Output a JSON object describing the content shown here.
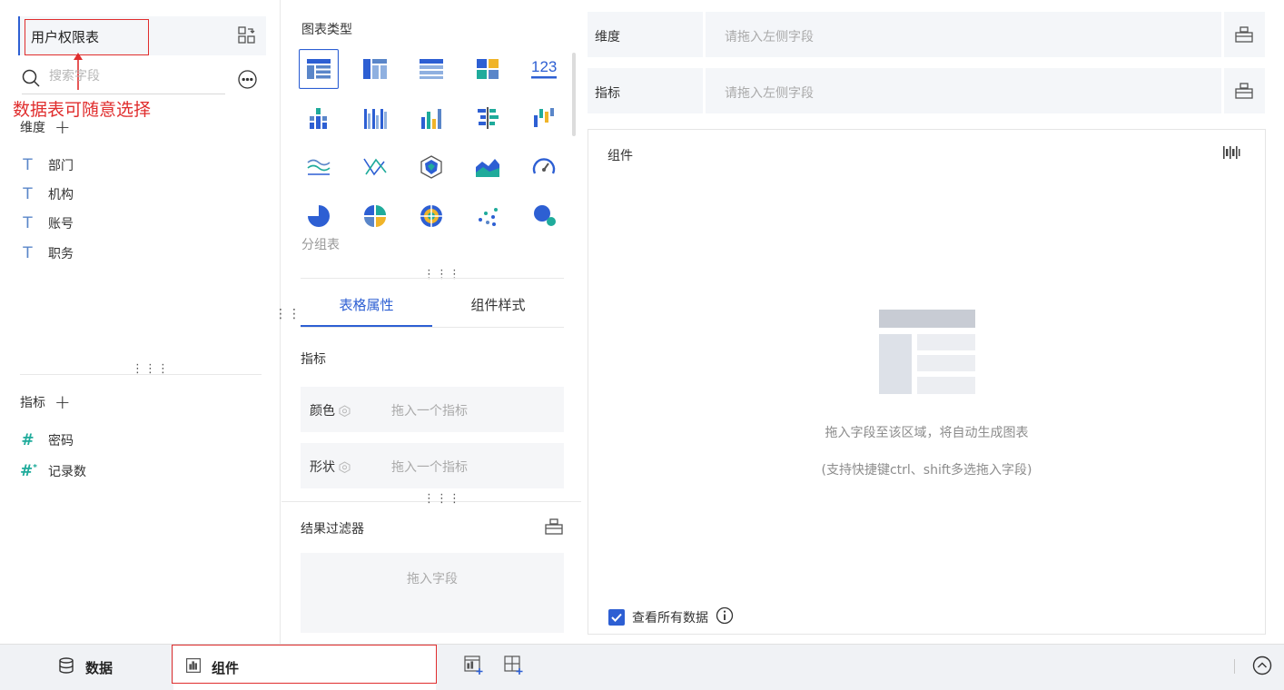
{
  "left": {
    "table_name": "用户权限表",
    "annotation": "数据表可随意选择",
    "search_placeholder": "搜索字段",
    "dimension_label": "维度",
    "dimensions": [
      "部门",
      "机构",
      "账号",
      "职务"
    ],
    "metric_label": "指标",
    "metrics": [
      "密码",
      "记录数"
    ]
  },
  "middle": {
    "chart_type_title": "图表类型",
    "chart_type_icons": [
      "grouped-table-icon",
      "cross-table-icon",
      "detail-table-icon",
      "kpi-card-icon",
      "number-123-icon",
      "stacked-bar-icon",
      "multi-bar-icon",
      "column-chart-icon",
      "horizontal-bar-icon",
      "range-bar-icon",
      "line-chart-icon",
      "scatter-lines-icon",
      "radar-chart-icon",
      "area-chart-icon",
      "gauge-icon",
      "pie-chart-icon",
      "split-pie-icon",
      "rose-chart-icon",
      "dot-chart-icon",
      "bubble-chart-icon"
    ],
    "selected_chart_name": "分组表",
    "tabs": [
      "表格属性",
      "组件样式"
    ],
    "active_tab": "表格属性",
    "prop_section_label": "指标",
    "color_label": "颜色",
    "color_hint": "拖入一个指标",
    "shape_label": "形状",
    "shape_hint": "拖入一个指标",
    "filter_label": "结果过滤器",
    "filter_hint": "拖入字段"
  },
  "right": {
    "dimension_row_label": "维度",
    "dimension_row_placeholder": "请拖入左侧字段",
    "metric_row_label": "指标",
    "metric_row_placeholder": "请拖入左侧字段",
    "canvas_title": "组件",
    "empty_message": "拖入字段至该区域，将自动生成图表",
    "empty_hint": "(支持快捷键ctrl、shift多选拖入字段)",
    "view_all_label": "查看所有数据"
  },
  "bottom": {
    "data_tab": "数据",
    "component_tab": "组件"
  },
  "colors": {
    "accent": "#2d5fd3",
    "annotation_red": "#e02d2d",
    "panel_bg": "#f4f6f9"
  }
}
